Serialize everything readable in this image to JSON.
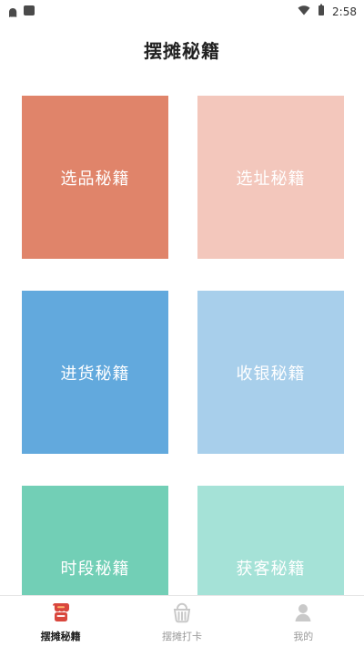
{
  "status_bar": {
    "time": "2:58",
    "left_icons": [
      "notification-ghost-icon",
      "notification-square-icon"
    ],
    "right_icons": [
      "wifi-icon",
      "battery-icon"
    ]
  },
  "header": {
    "title": "摆摊秘籍"
  },
  "tiles": [
    {
      "label": "选品秘籍",
      "color": "#E0846A"
    },
    {
      "label": "选址秘籍",
      "color": "#F3C7BC"
    },
    {
      "label": "进货秘籍",
      "color": "#62A9DD"
    },
    {
      "label": "收银秘籍",
      "color": "#A8CFEB"
    },
    {
      "label": "时段秘籍",
      "color": "#72CFB6"
    },
    {
      "label": "获客秘籍",
      "color": "#A5E2D7"
    }
  ],
  "bottom_nav": {
    "items": [
      {
        "label": "摆摊秘籍",
        "icon": "stall-icon",
        "active": true
      },
      {
        "label": "摆摊打卡",
        "icon": "basket-icon",
        "active": false
      },
      {
        "label": "我的",
        "icon": "person-icon",
        "active": false
      }
    ],
    "colors": {
      "active_icon": "#D9473D",
      "inactive_icon": "#C9C9C9"
    }
  }
}
